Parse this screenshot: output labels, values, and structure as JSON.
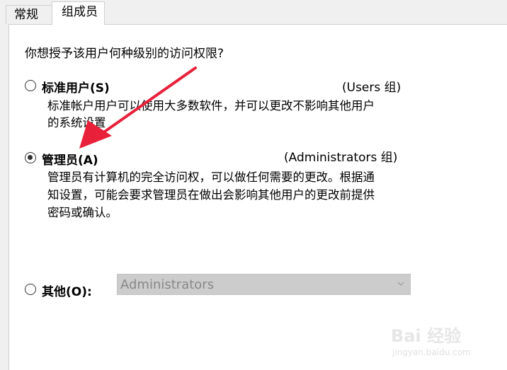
{
  "tabs": [
    {
      "label": "常规",
      "active": false
    },
    {
      "label": "组成员",
      "active": true
    }
  ],
  "question": "你想授予该用户何种级别的访问权限?",
  "options": {
    "standard": {
      "label": "标准用户(S)",
      "group": "(Users 组)",
      "description_line1": "标准帐户用户可以使用大多数软件，并可以更改不影响其他用户",
      "description_line2": "的系统设置",
      "selected": false
    },
    "admin": {
      "label": "管理员(A)",
      "group": "(Administrators 组)",
      "description_line1": "管理员有计算机的完全访问权，可以做任何需要的更改。根据通",
      "description_line2": "知设置，可能会要求管理员在做出会影响其他用户的更改前提供",
      "description_line3": "密码或确认。",
      "selected": true
    },
    "other": {
      "label": "其他(O):",
      "selected": false,
      "dropdown_value": "Administrators"
    }
  },
  "watermark": {
    "text": "Bai 经验",
    "url": "jingyan.baidu.com"
  },
  "colors": {
    "annotation_arrow": "#e8203a",
    "panel_bg": "#ffffff",
    "window_bg": "#f0f0f0",
    "dropdown_disabled": "#cccccc"
  }
}
